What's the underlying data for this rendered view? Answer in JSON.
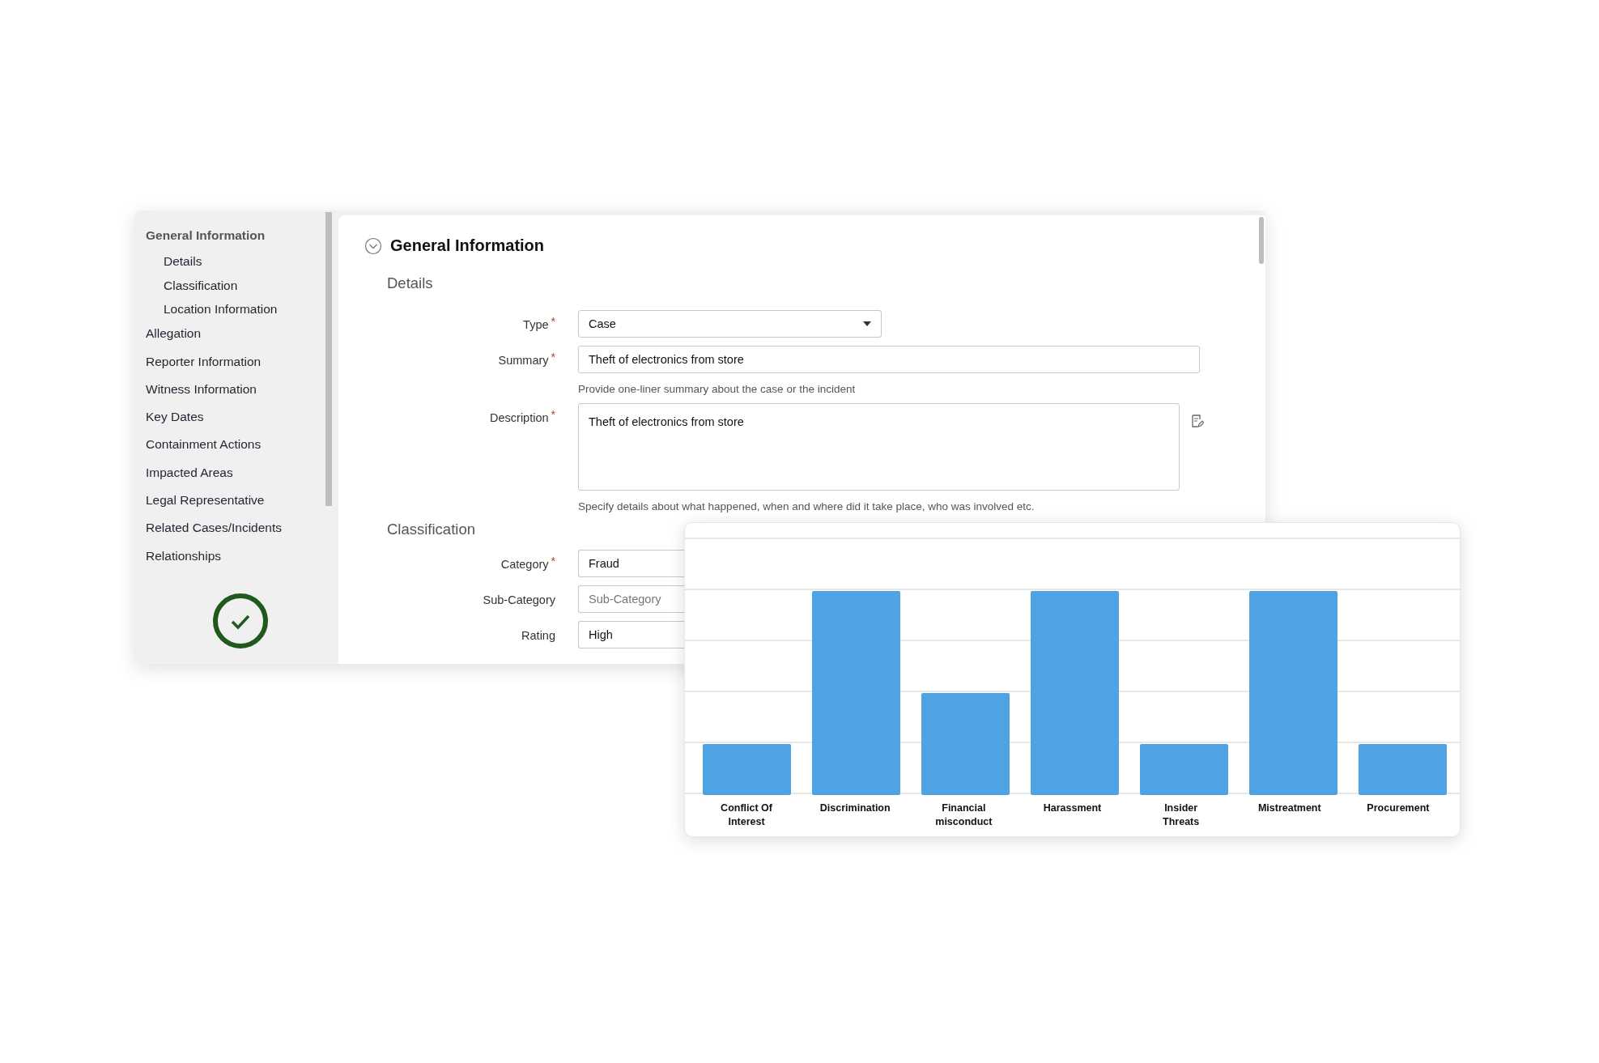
{
  "sidebar": {
    "items": [
      {
        "label": "General Information",
        "children": [
          {
            "label": "Details"
          },
          {
            "label": "Classification"
          },
          {
            "label": "Location Information"
          }
        ]
      },
      {
        "label": "Allegation"
      },
      {
        "label": "Reporter Information"
      },
      {
        "label": "Witness Information"
      },
      {
        "label": "Key Dates"
      },
      {
        "label": "Containment Actions"
      },
      {
        "label": "Impacted Areas"
      },
      {
        "label": "Legal Representative"
      },
      {
        "label": "Related Cases/Incidents"
      },
      {
        "label": "Relationships"
      }
    ]
  },
  "main": {
    "title": "General Information",
    "sections": [
      {
        "title": "Details",
        "fields": [
          {
            "kind": "select",
            "label": "Type",
            "required_mark": "*",
            "value": "Case"
          },
          {
            "kind": "text",
            "label": "Summary",
            "required_mark": "*",
            "value": "Theft of electronics from store",
            "hint": "Provide one-liner summary about the case or the incident"
          },
          {
            "kind": "textarea",
            "label": "Description",
            "required_mark": "*",
            "value": "Theft of electronics from store",
            "hint": "Specify details about what happened, when and where did it take place, who was involved etc."
          }
        ]
      },
      {
        "title": "Classification",
        "fields": [
          {
            "kind": "text",
            "label": "Category",
            "required_mark": "*",
            "value": "Fraud"
          },
          {
            "kind": "text",
            "label": "Sub-Category",
            "placeholder": "Sub-Category"
          },
          {
            "kind": "text",
            "label": "Rating",
            "value": "High"
          }
        ]
      }
    ]
  },
  "chart": {
    "categories": [
      "Conflict Of Interest",
      "Discrimination",
      "Financial misconduct",
      "Harassment",
      "Insider Threats",
      "Mistreatment",
      "Procurement"
    ]
  }
}
